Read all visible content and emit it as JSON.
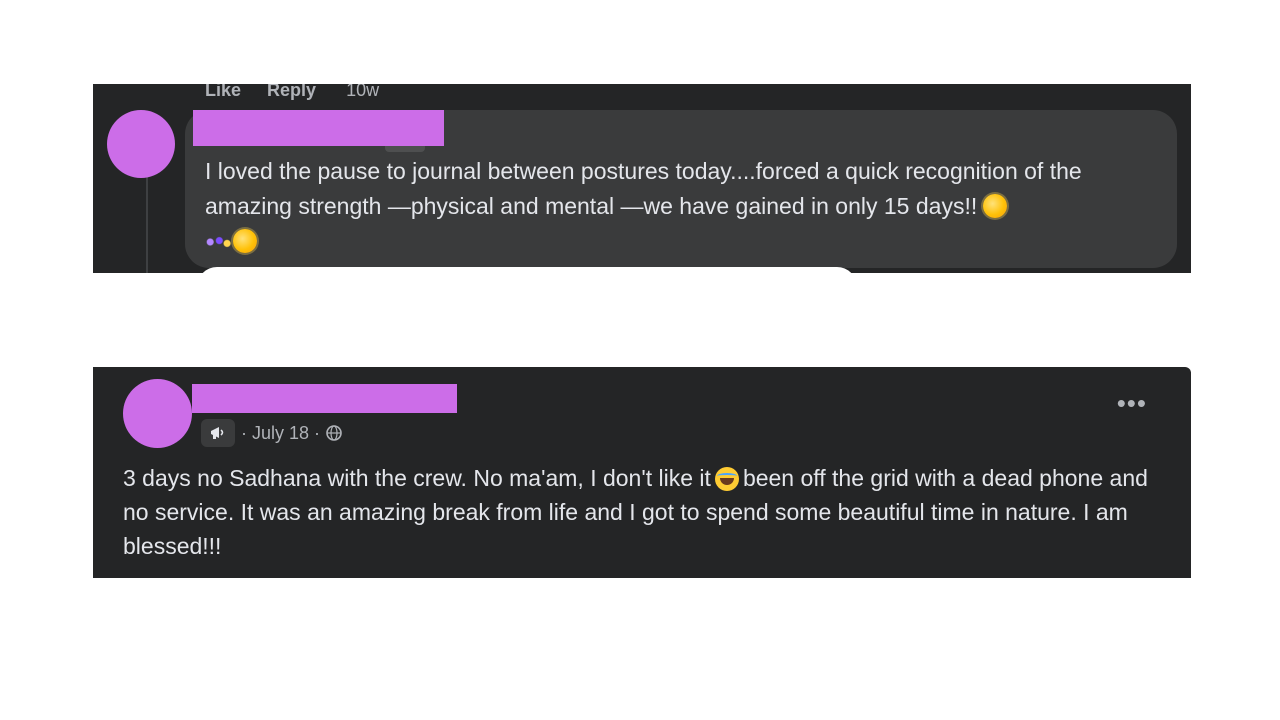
{
  "comment": {
    "prev_actions": {
      "like": "Like",
      "reply": "Reply",
      "time": "10w"
    },
    "text": "I loved the pause to journal between postures today....forced a quick recognition of the amazing strength —physical and mental —we have gained in only 15 days!!",
    "emojis": [
      "sun-emoji",
      "sparkles-emoji",
      "sun-emoji"
    ]
  },
  "post": {
    "date": "· July 18 ·",
    "privacy_icon": "globe-icon",
    "group_icon": "megaphone-icon",
    "more": "•••",
    "text_before_emoji": "3 days no Sadhana with the crew. No ma'am, I don't like it",
    "text_after_emoji": "been off the grid with a dead phone and no service. It was an amazing break from life and I got to spend some beautiful time in nature. I am blessed!!!",
    "emoji": "laughing-crying-emoji"
  },
  "colors": {
    "panel_bg": "#242526",
    "bubble_bg": "#3a3b3c",
    "redaction": "#cc6de8",
    "text": "#e4e6eb",
    "secondary_text": "#b0b3b8"
  }
}
